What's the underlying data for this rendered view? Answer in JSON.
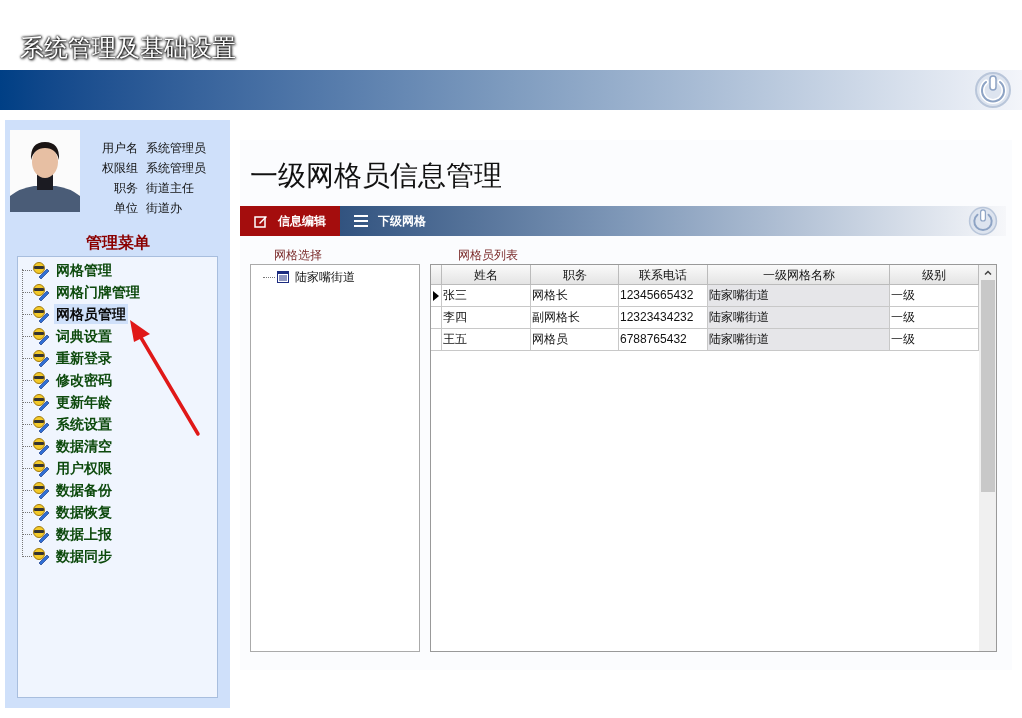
{
  "window": {
    "title": "系统管理及基础设置"
  },
  "user": {
    "fields": [
      {
        "label": "用户名",
        "value": "系统管理员"
      },
      {
        "label": "权限组",
        "value": "系统管理员"
      },
      {
        "label": "职务",
        "value": "街道主任"
      },
      {
        "label": "单位",
        "value": "街道办"
      }
    ]
  },
  "menu": {
    "title": "管理菜单",
    "items": [
      {
        "label": "网格管理",
        "selected": false
      },
      {
        "label": "网格门牌管理",
        "selected": false
      },
      {
        "label": "网格员管理",
        "selected": true
      },
      {
        "label": "词典设置",
        "selected": false
      },
      {
        "label": "重新登录",
        "selected": false
      },
      {
        "label": "修改密码",
        "selected": false
      },
      {
        "label": "更新年龄",
        "selected": false
      },
      {
        "label": "系统设置",
        "selected": false
      },
      {
        "label": "数据清空",
        "selected": false
      },
      {
        "label": "用户权限",
        "selected": false
      },
      {
        "label": "数据备份",
        "selected": false
      },
      {
        "label": "数据恢复",
        "selected": false
      },
      {
        "label": "数据上报",
        "selected": false
      },
      {
        "label": "数据同步",
        "selected": false
      }
    ]
  },
  "page": {
    "title": "一级网格员信息管理"
  },
  "toolbar": [
    {
      "label": "信息编辑",
      "selected": true,
      "kind": "edit"
    },
    {
      "label": "下级网格",
      "selected": false,
      "kind": "list"
    }
  ],
  "grid_tree": {
    "title": "网格选择",
    "items": [
      {
        "label": "陆家嘴街道"
      }
    ]
  },
  "table": {
    "title": "网格员列表",
    "columns": [
      "姓名",
      "职务",
      "联系电话",
      "一级网格名称",
      "级别"
    ],
    "rows": [
      {
        "cells": [
          "张三",
          "网格长",
          "12345665432",
          "陆家嘴街道",
          "一级"
        ],
        "selected": true
      },
      {
        "cells": [
          "李四",
          "副网格长",
          "12323434232",
          "陆家嘴街道",
          "一级"
        ],
        "selected": false
      },
      {
        "cells": [
          "王五",
          "网格员",
          "6788765432",
          "陆家嘴街道",
          "一级"
        ],
        "selected": false
      }
    ]
  }
}
